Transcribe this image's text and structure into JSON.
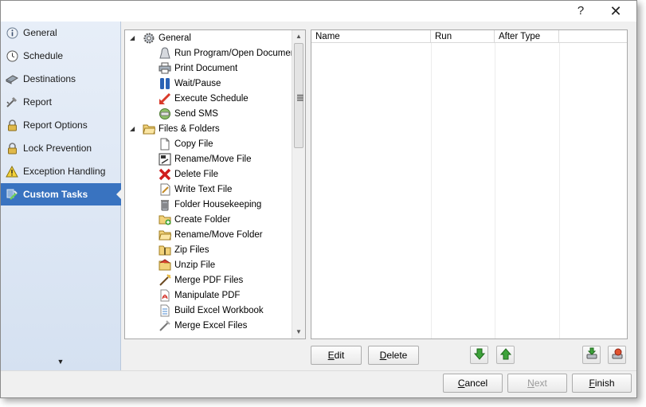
{
  "window": {
    "help_label": "?",
    "close_label": "✕"
  },
  "sidebar": {
    "items": [
      {
        "label": "General",
        "icon": "info-icon"
      },
      {
        "label": "Schedule",
        "icon": "clock-icon"
      },
      {
        "label": "Destinations",
        "icon": "destinations-icon"
      },
      {
        "label": "Report",
        "icon": "report-icon"
      },
      {
        "label": "Report Options",
        "icon": "lock-icon"
      },
      {
        "label": "Lock Prevention",
        "icon": "lock-icon"
      },
      {
        "label": "Exception Handling",
        "icon": "warning-icon"
      },
      {
        "label": "Custom Tasks",
        "icon": "custom-tasks-icon",
        "active": true
      }
    ],
    "scroll_glyph": "▼"
  },
  "tree": {
    "groups": [
      {
        "label": "General",
        "icon": "gear-icon",
        "expanded": true,
        "items": [
          {
            "label": "Run Program/Open Document",
            "icon": "run-program-icon"
          },
          {
            "label": "Print Document",
            "icon": "printer-icon"
          },
          {
            "label": "Wait/Pause",
            "icon": "pause-icon"
          },
          {
            "label": "Execute Schedule",
            "icon": "execute-icon"
          },
          {
            "label": "Send SMS",
            "icon": "sms-icon"
          }
        ]
      },
      {
        "label": "Files & Folders",
        "icon": "folder-icon",
        "expanded": true,
        "items": [
          {
            "label": "Copy File",
            "icon": "copy-file-icon"
          },
          {
            "label": "Rename/Move File",
            "icon": "rename-file-icon"
          },
          {
            "label": "Delete File",
            "icon": "delete-file-icon"
          },
          {
            "label": "Write Text File",
            "icon": "write-text-icon"
          },
          {
            "label": "Folder Housekeeping",
            "icon": "housekeeping-icon"
          },
          {
            "label": "Create Folder",
            "icon": "create-folder-icon"
          },
          {
            "label": "Rename/Move Folder",
            "icon": "rename-folder-icon"
          },
          {
            "label": "Zip Files",
            "icon": "zip-icon"
          },
          {
            "label": "Unzip File",
            "icon": "unzip-icon"
          },
          {
            "label": "Merge PDF Files",
            "icon": "merge-pdf-icon"
          },
          {
            "label": "Manipulate PDF",
            "icon": "pdf-icon"
          },
          {
            "label": "Build Excel Workbook",
            "icon": "excel-icon"
          },
          {
            "label": "Merge Excel Files",
            "icon": "merge-excel-icon"
          }
        ]
      }
    ]
  },
  "grid": {
    "columns": [
      "Name",
      "Run",
      "After Type",
      ""
    ]
  },
  "task_buttons": {
    "edit": {
      "pre": "",
      "mnemonic": "E",
      "post": "dit"
    },
    "delete": {
      "pre": "",
      "mnemonic": "D",
      "post": "elete"
    }
  },
  "footer": {
    "cancel": {
      "pre": "",
      "mnemonic": "C",
      "post": "ancel"
    },
    "next": {
      "pre": "",
      "mnemonic": "N",
      "post": "ext"
    },
    "finish": {
      "pre": "",
      "mnemonic": "F",
      "post": "inish"
    }
  }
}
